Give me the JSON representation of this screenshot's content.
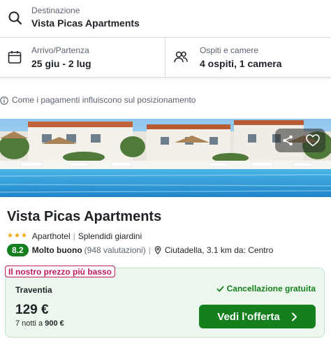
{
  "search": {
    "destination_label": "Destinazione",
    "destination_value": "Vista Picas Apartments",
    "dates_label": "Arrivo/Partenza",
    "dates_value": "25 giu - 2 lug",
    "guests_label": "Ospiti e camere",
    "guests_value": "4 ospiti, 1 camera"
  },
  "info_note": "Come i pagamenti influiscono sul posizionamento",
  "hotel": {
    "name": "Vista Picas Apartments",
    "star_count": 3,
    "type": "Aparthotel",
    "feature": "Splendidi giardini",
    "rating_score": "8.2",
    "rating_label": "Molto buono",
    "rating_count": "(948 valutazioni)",
    "location": "Ciutadella, 3.1 km da: Centro"
  },
  "offer": {
    "badge": "Il nostro prezzo più basso",
    "provider": "Traventia",
    "cancellation": "Cancellazione gratuita",
    "price": "129 €",
    "nights_prefix": "7 notti a",
    "nights_total": "900 €",
    "cta_label": "Vedi l'offerta"
  },
  "colors": {
    "accent_green": "#157e1d",
    "badge_pink": "#c2185b",
    "star_gold": "#f0a400",
    "offer_bg": "#ecf8ee"
  },
  "icons": [
    "search-icon",
    "calendar-icon",
    "guests-icon",
    "info-icon",
    "share-icon",
    "heart-icon",
    "star-icon",
    "location-pin-icon",
    "check-icon",
    "chevron-right-icon"
  ]
}
